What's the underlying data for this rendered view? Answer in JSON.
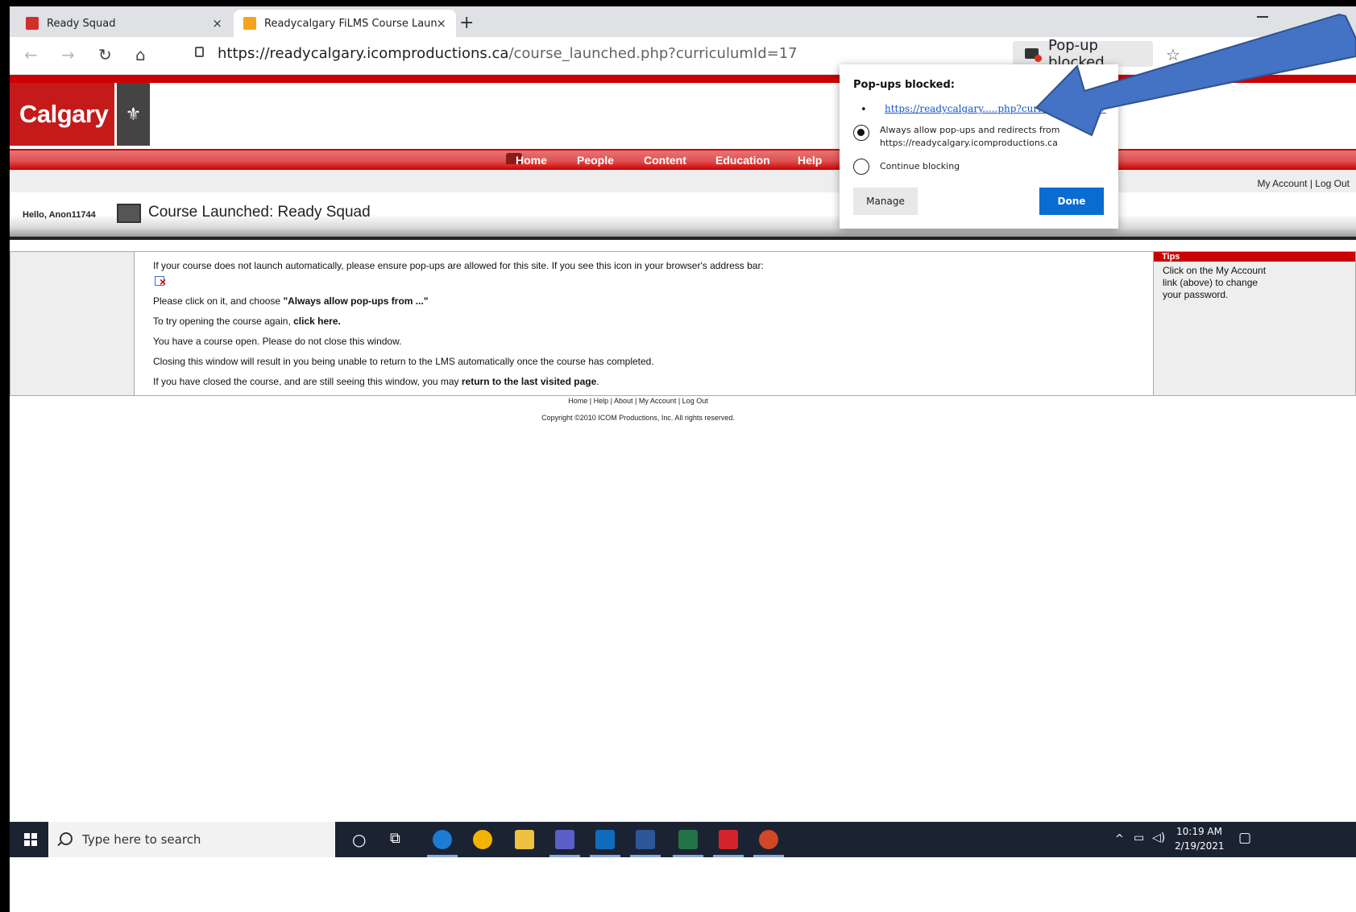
{
  "browser": {
    "tabs": [
      {
        "title": "Ready Squad",
        "close": "×"
      },
      {
        "title": "Readycalgary FiLMS Course Laun",
        "close": "×"
      }
    ],
    "new_tab": "+",
    "url_host": "https://readycalgary.icomproductions.ca",
    "url_path": "/course_launched.php?curriculumId=17",
    "popup_chip": "Pop-up blocked",
    "more": "···"
  },
  "site": {
    "logo_text": "Calgary",
    "menu": [
      "Home",
      "People",
      "Content",
      "Education",
      "Help"
    ],
    "account_links": {
      "my_account": "My Account",
      "sep": "|",
      "logout": "Log Out"
    },
    "hello": "Hello, Anon11744",
    "course_title": "Course Launched: Ready Squad"
  },
  "content": {
    "line1": "If your course does not launch automatically, please ensure pop-ups are allowed for this site. If you see this icon in your browser's address bar:",
    "line2_pre": "Please click on it, and choose ",
    "line2_bold": "\"Always allow pop-ups from ...\"",
    "line3_pre": "To try opening the course again, ",
    "line3_link": "click here.",
    "line4": "You have a course open. Please do not close this window.",
    "line5": "Closing this window will result in you being unable to return to the LMS automatically once the course has completed.",
    "line6_pre": "If you have closed the course, and are still seeing this window, you may ",
    "line6_link": "return to the last visited page",
    "line6_post": "."
  },
  "tips": {
    "title": "Tips",
    "body": "Click on the My Account link (above) to change your password."
  },
  "footer": {
    "links": "Home | Help | About | My Account | Log Out",
    "copyright": "Copyright ©2010 ICOM Productions, Inc. All rights reserved."
  },
  "popup_panel": {
    "title": "Pop-ups blocked:",
    "bullet": "•",
    "link": "https://readycalgary.....php?curriculumId=17",
    "option_allow": "Always allow pop-ups and redirects from https://readycalgary.icomproductions.ca",
    "option_block": "Continue blocking",
    "manage": "Manage",
    "done": "Done",
    "selected": "allow"
  },
  "taskbar": {
    "search_placeholder": "Type here to search",
    "time": "10:19 AM",
    "date": "2/19/2021"
  },
  "colors": {
    "brand_red": "#c00000",
    "done_blue": "#0a6cd0",
    "arrow_blue": "#4472c4",
    "taskbar": "#1b2333"
  }
}
